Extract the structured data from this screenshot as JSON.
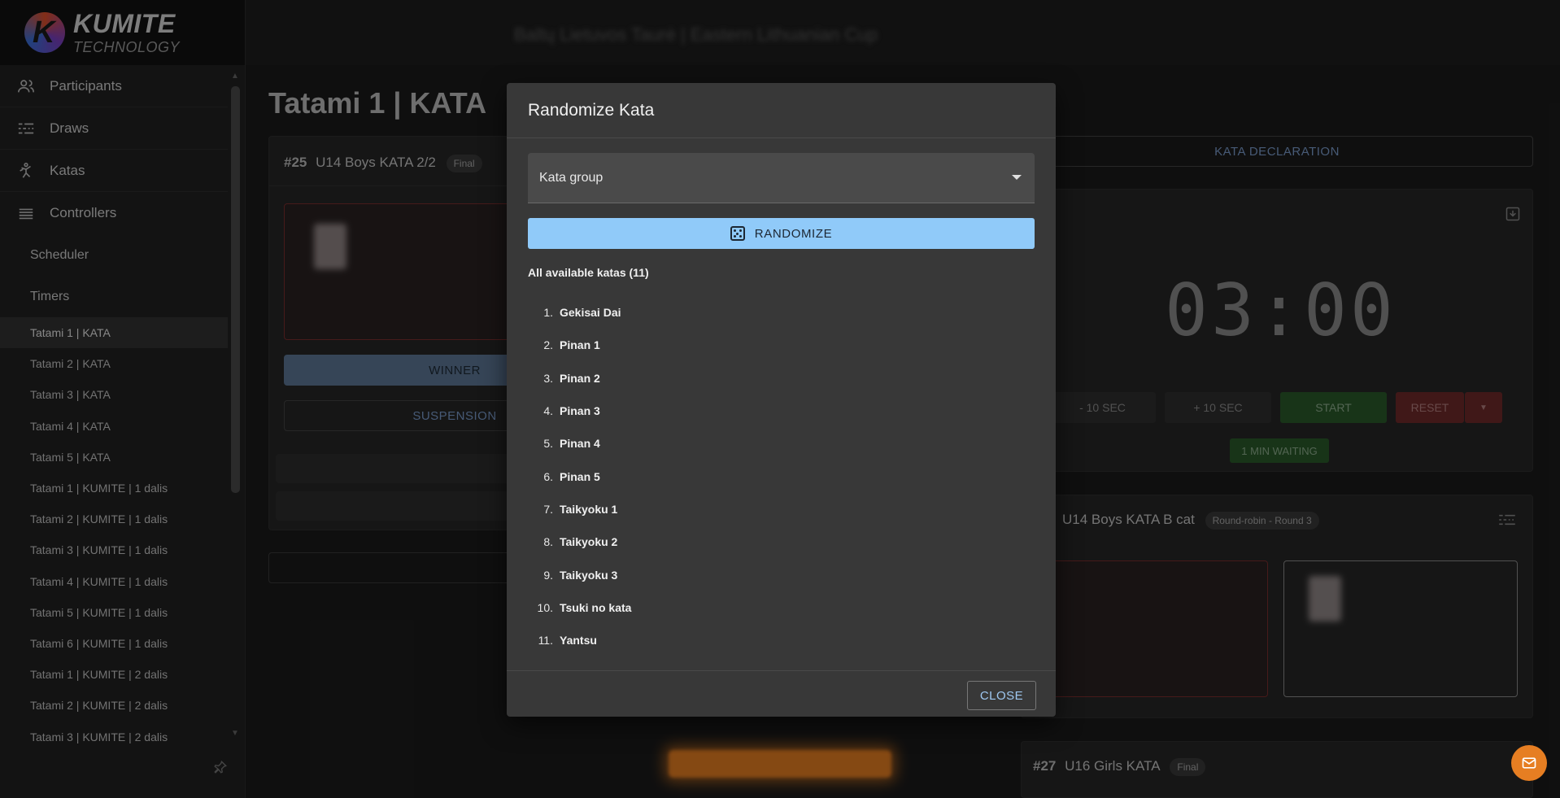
{
  "app": {
    "logo_title": "KUMITE",
    "logo_subtitle": "TECHNOLOGY",
    "topbar_title": "Baltų Lietuvos Taurė | Eastern Lithuanian Cup"
  },
  "sidebar": {
    "items": [
      {
        "label": "Participants",
        "icon": "participants-icon"
      },
      {
        "label": "Draws",
        "icon": "draws-icon"
      },
      {
        "label": "Katas",
        "icon": "katas-icon"
      },
      {
        "label": "Controllers",
        "icon": "controllers-icon"
      }
    ],
    "sub_items": [
      "Scheduler",
      "Timers"
    ],
    "timer_items": [
      "Tatami 1 | KATA",
      "Tatami 2 | KATA",
      "Tatami 3 | KATA",
      "Tatami 4 | KATA",
      "Tatami 5 | KATA",
      "Tatami 1 | KUMITE | 1 dalis",
      "Tatami 2 | KUMITE | 1 dalis",
      "Tatami 3 | KUMITE | 1 dalis",
      "Tatami 4 | KUMITE | 1 dalis",
      "Tatami 5 | KUMITE | 1 dalis",
      "Tatami 6 | KUMITE | 1 dalis",
      "Tatami 1 | KUMITE | 2 dalis",
      "Tatami 2 | KUMITE | 2 dalis",
      "Tatami 3 | KUMITE | 2 dalis"
    ],
    "active_item": "Tatami 1 | KATA"
  },
  "main": {
    "page_title": "Tatami 1 | KATA",
    "match1": {
      "number": "#25",
      "title": "U14 Boys KATA 2/2",
      "badge": "Final",
      "winner_label": "WINNER",
      "suspension_label": "SUSPENSION"
    },
    "kata_declaration_label": "KATA DECLARATION",
    "timer": {
      "value": "03:00",
      "minus_label": "- 10 SEC",
      "plus_label": "+ 10 SEC",
      "start_label": "START",
      "reset_label": "RESET",
      "waiting_label": "1 MIN WAITING"
    },
    "match2": {
      "title": "U14 Boys KATA B cat",
      "badge": "Round-robin - Round 3"
    },
    "match3": {
      "number": "#27",
      "title": "U16 Girls KATA",
      "badge": "Final"
    }
  },
  "dialog": {
    "title": "Randomize Kata",
    "select_label": "Kata group",
    "randomize_label": "RANDOMIZE",
    "available_label": "All available katas (11)",
    "katas": [
      "Gekisai Dai",
      "Pinan 1",
      "Pinan 2",
      "Pinan 3",
      "Pinan 4",
      "Pinan 5",
      "Taikyoku 1",
      "Taikyoku 2",
      "Taikyoku 3",
      "Tsuki no kata",
      "Yantsu"
    ],
    "close_label": "CLOSE"
  },
  "colors": {
    "accent": "#90caf9",
    "fab": "#e67e22",
    "start": "#2e7d32",
    "reset": "#b23a3a"
  }
}
